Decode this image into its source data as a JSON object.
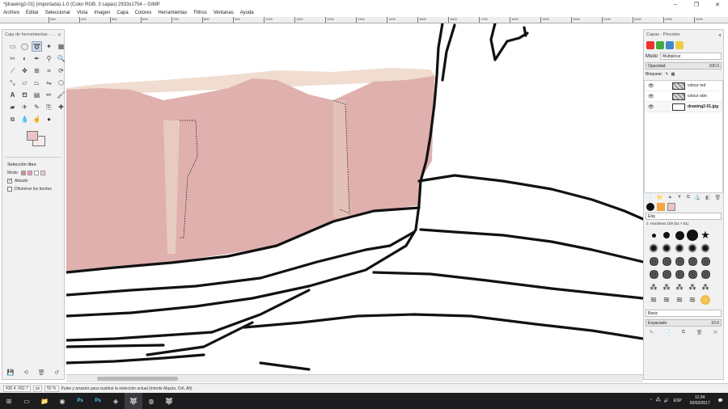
{
  "window": {
    "title": "*[drawing2-01] (importada)-1.0 (Color RGB, 3 capas) 2933x1754 – GIMP",
    "min": "–",
    "max": "❐",
    "close": "✕"
  },
  "menubar": [
    "Archivo",
    "Editar",
    "Seleccionar",
    "Vista",
    "Imagen",
    "Capa",
    "Colores",
    "Herramientas",
    "Filtros",
    "Ventanas",
    "Ayuda"
  ],
  "ruler": [
    "300",
    "400",
    "500",
    "600",
    "700",
    "800",
    "900",
    "1000",
    "1100",
    "1200",
    "1300",
    "1400",
    "1500",
    "1600",
    "1700",
    "1800",
    "1900",
    "2000",
    "2100",
    "2200",
    "2300",
    "2400"
  ],
  "toolbox": {
    "title": "Caja de herramientas - ...",
    "close": "✕",
    "options_title": "Selección libre",
    "mode_label": "Modo:",
    "antialias_label": "Alisado",
    "antialias_checked": "✓",
    "feather_label": "Difuminar los bordes"
  },
  "layers": {
    "title": "Capas - Pinceles",
    "mode_label": "Modo",
    "mode_value": "Multiplicar",
    "opacity_label": "Opacidad",
    "opacity_value": "100.0",
    "lock_label": "Bloquear:",
    "items": [
      {
        "name": "colour red"
      },
      {
        "name": "colour skin"
      },
      {
        "name": "drawing2-01.jpg"
      }
    ]
  },
  "brushes": {
    "filter": "Etiq",
    "current": "2. Hardness 100 (51 × 51)",
    "preset": "Basic",
    "spacing_label": "Espaciado",
    "spacing_value": "10.0"
  },
  "status": {
    "coords": "430.4, 682.7",
    "unit": "px",
    "zoom": "55 %",
    "message": "Pulse y arrastre para sustituir la selección actual (intente Mayús, Ctrl, Alt)"
  },
  "taskbar": {
    "lang": "ESP",
    "time": "11:34",
    "date": "02/02/2017"
  },
  "colors": {
    "pink": "#dfb0ad",
    "skin": "#f0dcd0",
    "fg": "#e9c5c5"
  }
}
